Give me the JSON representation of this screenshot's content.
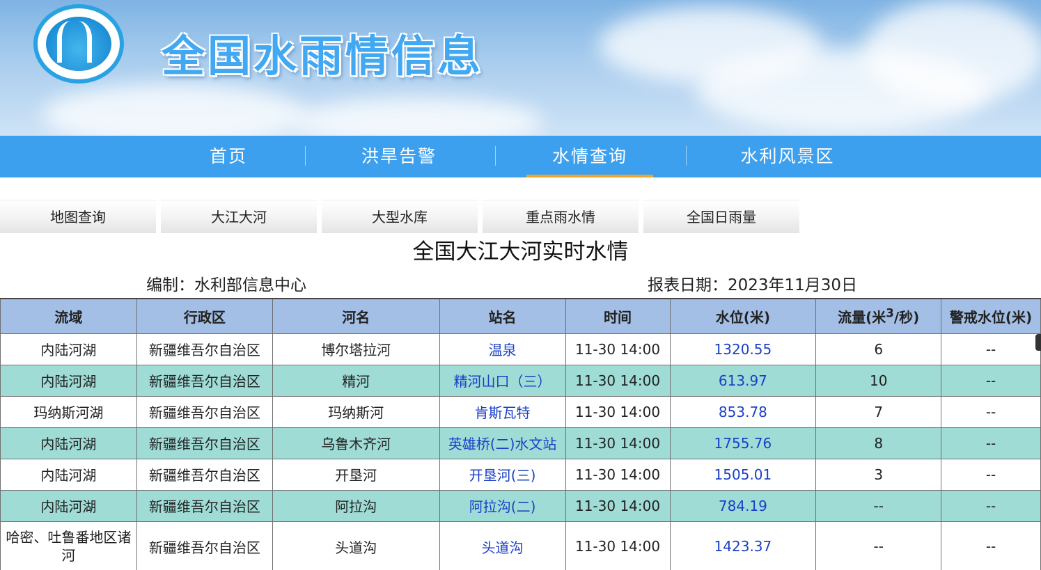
{
  "site": {
    "title": "全国水雨情信息"
  },
  "main_nav": [
    {
      "label": "首页"
    },
    {
      "label": "洪旱告警"
    },
    {
      "label": "水情查询",
      "active": true
    },
    {
      "label": "水利风景区"
    }
  ],
  "sub_tabs": [
    {
      "label": "地图查询"
    },
    {
      "label": "大江大河",
      "active": true
    },
    {
      "label": "大型水库"
    },
    {
      "label": "重点雨水情"
    },
    {
      "label": "全国日雨量"
    }
  ],
  "report": {
    "title": "全国大江大河实时水情",
    "compiler": "编制：水利部信息中心",
    "date": "报表日期：2023年11月30日"
  },
  "table": {
    "headers": {
      "basin": "流域",
      "region": "行政区",
      "river": "河名",
      "station": "站名",
      "time": "时间",
      "level": "水位(米)",
      "flow_prefix": "流量(米",
      "flow_sup": "3",
      "flow_suffix": "/秒)",
      "warning": "警戒水位(米)"
    },
    "rows": [
      {
        "basin": "内陆河湖",
        "region": "新疆维吾尔自治区",
        "river": "博尔塔拉河",
        "station": "温泉",
        "time": "11-30 14:00",
        "level": "1320.55",
        "flow": "6",
        "warning": "--"
      },
      {
        "basin": "内陆河湖",
        "region": "新疆维吾尔自治区",
        "river": "精河",
        "station": "精河山口（三）",
        "time": "11-30 14:00",
        "level": "613.97",
        "flow": "10",
        "warning": "--"
      },
      {
        "basin": "玛纳斯河湖",
        "region": "新疆维吾尔自治区",
        "river": "玛纳斯河",
        "station": "肯斯瓦特",
        "time": "11-30 14:00",
        "level": "853.78",
        "flow": "7",
        "warning": "--"
      },
      {
        "basin": "内陆河湖",
        "region": "新疆维吾尔自治区",
        "river": "乌鲁木齐河",
        "station": "英雄桥(二)水文站",
        "time": "11-30 14:00",
        "level": "1755.76",
        "flow": "8",
        "warning": "--"
      },
      {
        "basin": "内陆河湖",
        "region": "新疆维吾尔自治区",
        "river": "开垦河",
        "station": "开垦河(三)",
        "time": "11-30 14:00",
        "level": "1505.01",
        "flow": "3",
        "warning": "--"
      },
      {
        "basin": "内陆河湖",
        "region": "新疆维吾尔自治区",
        "river": "阿拉沟",
        "station": "阿拉沟(二)",
        "time": "11-30 14:00",
        "level": "784.19",
        "flow": "--",
        "warning": "--"
      },
      {
        "basin": "哈密、吐鲁番地区诸河",
        "region": "新疆维吾尔自治区",
        "river": "头道沟",
        "station": "头道沟",
        "time": "11-30 14:00",
        "level": "1423.37",
        "flow": "--",
        "warning": "--"
      }
    ]
  },
  "colors": {
    "nav": "#3da0ee",
    "active_underline": "#f2a52c",
    "header_row": "#a3bfe6",
    "alt_row": "#a0dcd6",
    "link": "#1a3fc7"
  }
}
